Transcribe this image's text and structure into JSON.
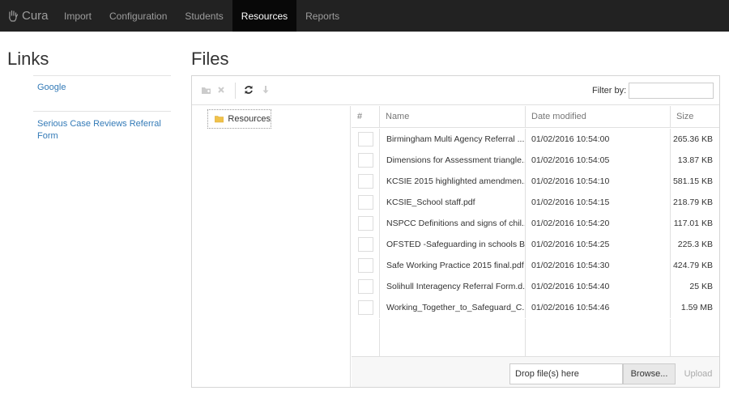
{
  "navbar": {
    "brand": "Cura",
    "items": [
      {
        "label": "Import",
        "active": false
      },
      {
        "label": "Configuration",
        "active": false
      },
      {
        "label": "Students",
        "active": false
      },
      {
        "label": "Resources",
        "active": true
      },
      {
        "label": "Reports",
        "active": false
      }
    ]
  },
  "links": {
    "title": "Links",
    "items": [
      "Google",
      "Serious Case Reviews Referral Form"
    ]
  },
  "files": {
    "title": "Files",
    "filter_label": "Filter by:",
    "filter_value": "",
    "tree": {
      "root": "Resources"
    },
    "columns": {
      "select": "#",
      "name": "Name",
      "date": "Date modified",
      "size": "Size"
    },
    "rows": [
      {
        "name": "Birmingham Multi Agency Referral ...",
        "date": "01/02/2016 10:54:00",
        "size": "265.36 KB"
      },
      {
        "name": "Dimensions for Assessment triangle...",
        "date": "01/02/2016 10:54:05",
        "size": "13.87 KB"
      },
      {
        "name": "KCSIE 2015 highlighted amendmen...",
        "date": "01/02/2016 10:54:10",
        "size": "581.15 KB"
      },
      {
        "name": "KCSIE_School staff.pdf",
        "date": "01/02/2016 10:54:15",
        "size": "218.79 KB"
      },
      {
        "name": "NSPCC Definitions and signs of chil...",
        "date": "01/02/2016 10:54:20",
        "size": "117.01 KB"
      },
      {
        "name": "OFSTED -Safeguarding in schools B...",
        "date": "01/02/2016 10:54:25",
        "size": "225.3 KB"
      },
      {
        "name": "Safe Working Practice 2015 final.pdf",
        "date": "01/02/2016 10:54:30",
        "size": "424.79 KB"
      },
      {
        "name": "Solihull Interagency Referral Form.d...",
        "date": "01/02/2016 10:54:40",
        "size": "25 KB"
      },
      {
        "name": "Working_Together_to_Safeguard_C...",
        "date": "01/02/2016 10:54:46",
        "size": "1.59 MB"
      }
    ],
    "upload": {
      "drop_label": "Drop file(s) here",
      "browse_label": "Browse...",
      "upload_label": "Upload"
    },
    "icons": [
      "new-folder-icon",
      "delete-icon",
      "refresh-icon",
      "download-icon",
      "folder-icon"
    ],
    "colors": {
      "folder": "#f0c24b",
      "link": "#337ab7",
      "navbar": "#222222"
    }
  }
}
